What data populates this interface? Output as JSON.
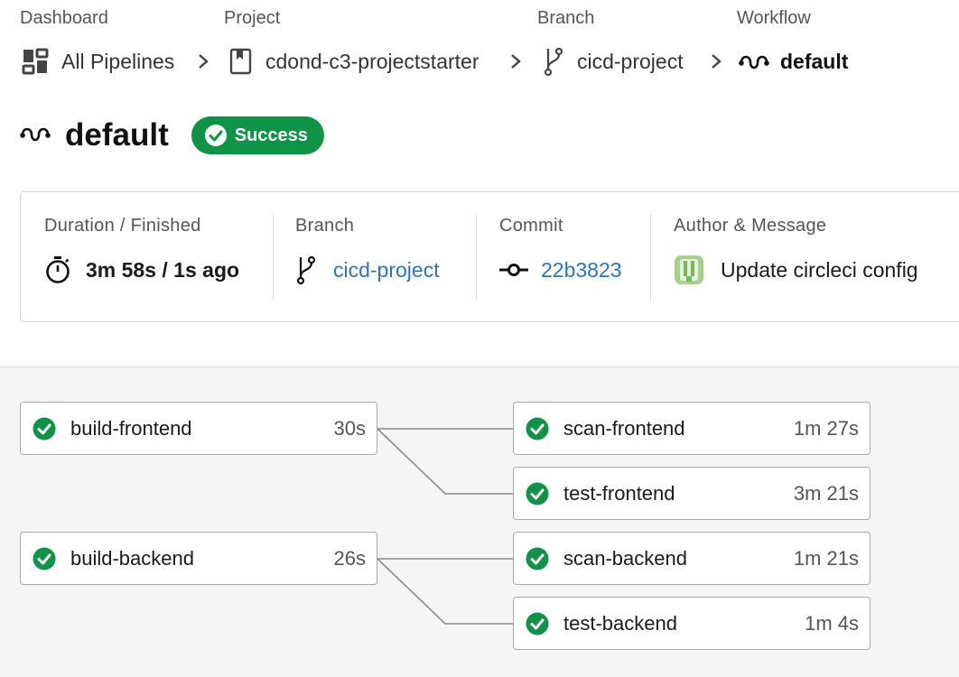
{
  "breadcrumb": {
    "labels": {
      "dashboard": "Dashboard",
      "project": "Project",
      "branch": "Branch",
      "workflow": "Workflow"
    },
    "items": {
      "dashboard": "All Pipelines",
      "project": "cdond-c3-projectstarter",
      "branch": "cicd-project",
      "workflow": "default"
    }
  },
  "workflow": {
    "title": "default",
    "status": "Success",
    "status_color": "#109346"
  },
  "info": {
    "duration_label": "Duration / Finished",
    "duration_value": "3m 58s / 1s ago",
    "branch_label": "Branch",
    "branch_value": "cicd-project",
    "commit_label": "Commit",
    "commit_value": "22b3823",
    "author_label": "Author & Message",
    "author_message": "Update circleci config",
    "link_color": "#2d75b7"
  },
  "jobs": {
    "build_frontend": {
      "name": "build-frontend",
      "duration": "30s"
    },
    "scan_frontend": {
      "name": "scan-frontend",
      "duration": "1m 27s"
    },
    "test_frontend": {
      "name": "test-frontend",
      "duration": "3m 21s"
    },
    "build_backend": {
      "name": "build-backend",
      "duration": "26s"
    },
    "scan_backend": {
      "name": "scan-backend",
      "duration": "1m 21s"
    },
    "test_backend": {
      "name": "test-backend",
      "duration": "1m 4s"
    }
  },
  "icons": {
    "dashboard": "dashboard-grid-icon",
    "project": "book-icon",
    "branch": "git-branch-icon",
    "workflow": "workflow-icon",
    "separator": "chevron-right-icon",
    "success": "check-circle-icon",
    "duration": "stopwatch-icon",
    "commit": "git-commit-icon",
    "author": "avatar"
  }
}
